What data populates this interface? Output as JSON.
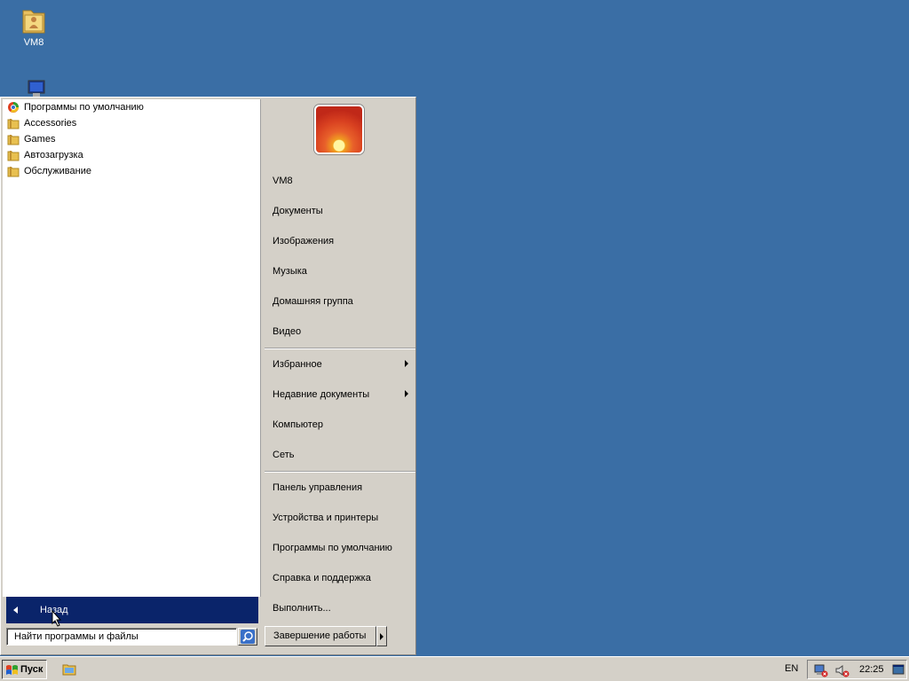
{
  "desktop": {
    "icons": [
      {
        "label": "VM8",
        "icon": "user-folder-icon"
      },
      {
        "label": "",
        "icon": "computer-icon"
      }
    ],
    "background": "#3a6ea5"
  },
  "start_menu": {
    "programs": [
      {
        "label": "Программы по умолчанию",
        "icon": "default-programs-icon"
      },
      {
        "label": "Accessories",
        "icon": "folder-icon"
      },
      {
        "label": "Games",
        "icon": "folder-icon"
      },
      {
        "label": "Автозагрузка",
        "icon": "folder-icon"
      },
      {
        "label": "Обслуживание",
        "icon": "folder-icon"
      }
    ],
    "back_label": "Назад",
    "search_placeholder": "Найти программы и файлы",
    "right_items": {
      "user": "VM8",
      "documents": "Документы",
      "pictures": "Изображения",
      "music": "Музыка",
      "homegroup": "Домашняя группа",
      "video": "Видео",
      "favorites": "Избранное",
      "recent": "Недавние документы",
      "computer": "Компьютер",
      "network": "Сеть",
      "control_panel": "Панель управления",
      "devices": "Устройства и принтеры",
      "default_programs": "Программы по умолчанию",
      "help": "Справка и поддержка",
      "run": "Выполнить..."
    },
    "shutdown_label": "Завершение работы"
  },
  "taskbar": {
    "start_label": "Пуск",
    "language": "EN",
    "clock": "22:25"
  },
  "colors": {
    "highlight": "#0a246a",
    "face": "#d4d0c8"
  }
}
